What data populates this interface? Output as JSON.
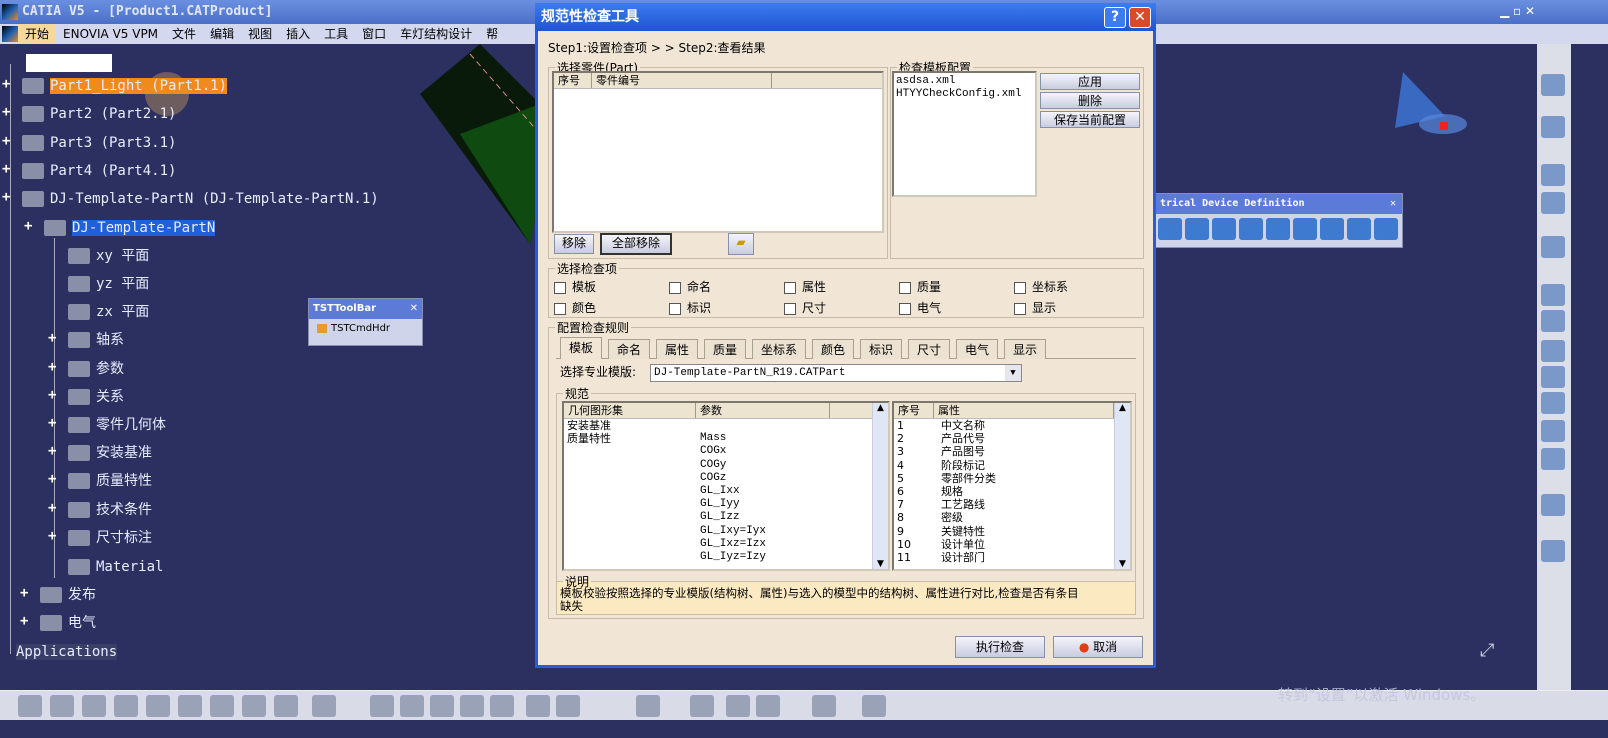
{
  "window": {
    "title": "CATIA V5 - [Product1.CATProduct]"
  },
  "menu": [
    "开始",
    "ENOVIA V5 VPM",
    "文件",
    "编辑",
    "视图",
    "插入",
    "工具",
    "窗口",
    "车灯结构设计",
    "帮"
  ],
  "tree": {
    "items": [
      {
        "label": "Part1_Light (Part1.1)",
        "selected": true
      },
      {
        "label": "Part2 (Part2.1)"
      },
      {
        "label": "Part3 (Part3.1)"
      },
      {
        "label": "Part4 (Part4.1)"
      },
      {
        "label": "DJ-Template-PartN (DJ-Template-PartN.1)"
      },
      {
        "label": "DJ-Template-PartN",
        "highlight": true
      },
      {
        "label": "xy 平面"
      },
      {
        "label": "yz 平面"
      },
      {
        "label": "zx 平面"
      },
      {
        "label": "轴系"
      },
      {
        "label": "参数"
      },
      {
        "label": "关系"
      },
      {
        "label": "零件几何体"
      },
      {
        "label": "安装基准"
      },
      {
        "label": "质量特性"
      },
      {
        "label": "技术条件"
      },
      {
        "label": "尺寸标注"
      },
      {
        "label": "Material"
      },
      {
        "label": "发布"
      },
      {
        "label": "电气"
      },
      {
        "label": "Applications"
      }
    ]
  },
  "tst_toolbar": {
    "title": "TSTToolBar",
    "command": "TSTCmdHdr"
  },
  "electrical_toolbar": {
    "title": "trical Device Definition"
  },
  "dialog": {
    "title": "规范性检查工具",
    "steps": "Step1:设置检查项 > > Step2:查看结果",
    "parts": {
      "legend": "选择零件(Part)",
      "columns": [
        "序号",
        "零件编号"
      ],
      "remove": "移除",
      "remove_all": "全部移除"
    },
    "templates": {
      "legend": "检查模板配置",
      "files": [
        "asdsa.xml",
        "HTYYCheckConfig.xml"
      ],
      "apply": "应用",
      "delete": "删除",
      "save": "保存当前配置"
    },
    "check_items": {
      "legend": "选择检查项",
      "items": [
        "模板",
        "命名",
        "属性",
        "质量",
        "坐标系",
        "颜色",
        "标识",
        "尺寸",
        "电气",
        "显示"
      ]
    },
    "rules": {
      "legend": "配置检查规则",
      "tabs": [
        "模板",
        "命名",
        "属性",
        "质量",
        "坐标系",
        "颜色",
        "标识",
        "尺寸",
        "电气",
        "显示"
      ],
      "template_label": "选择专业模版:",
      "template_value": "DJ-Template-PartN_R19.CATPart",
      "spec_legend": "规范",
      "geo_columns": [
        "几何图形集",
        "参数"
      ],
      "geo_rows": [
        [
          "安装基准",
          ""
        ],
        [
          "质量特性",
          "Mass"
        ],
        [
          "",
          "COGx"
        ],
        [
          "",
          "COGy"
        ],
        [
          "",
          "COGz"
        ],
        [
          "",
          "GL_Ixx"
        ],
        [
          "",
          "GL_Iyy"
        ],
        [
          "",
          "GL_Izz"
        ],
        [
          "",
          "GL_Ixy=Iyx"
        ],
        [
          "",
          "GL_Ixz=Izx"
        ],
        [
          "",
          "GL_Iyz=Izy"
        ]
      ],
      "attr_columns": [
        "序号",
        "属性"
      ],
      "attr_rows": [
        [
          "1",
          "中文名称"
        ],
        [
          "2",
          "产品代号"
        ],
        [
          "3",
          "产品图号"
        ],
        [
          "4",
          "阶段标记"
        ],
        [
          "5",
          "零部件分类"
        ],
        [
          "6",
          "规格"
        ],
        [
          "7",
          "工艺路线"
        ],
        [
          "8",
          "密级"
        ],
        [
          "9",
          "关键特性"
        ],
        [
          "10",
          "设计单位"
        ],
        [
          "11",
          "设计部门"
        ]
      ]
    },
    "note": {
      "legend": "说明",
      "text": "模板校验按照选择的专业模版(结构树、属性)与选入的模型中的结构树、属性进行对比,检查是否有条目缺失"
    },
    "run": "执行检查",
    "cancel": "取消"
  },
  "watermark": "转到“设置”以激活 Windows。",
  "colors": {
    "background": "#2b3060",
    "dialog_title": "#1e55d0",
    "selection": "#f08a1c"
  }
}
